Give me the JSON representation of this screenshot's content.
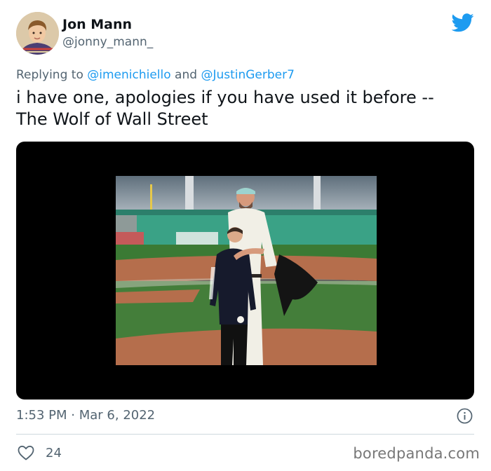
{
  "tweet": {
    "author": {
      "display_name": "Jon Mann",
      "handle": "@jonny_mann_",
      "avatar_icon": "child-portrait-avatar"
    },
    "reply_prefix": "Replying to",
    "reply_mentions": [
      "@imenichiello",
      "@JustinGerber7"
    ],
    "reply_joiner": "and",
    "text_line1": "i have one, apologies if you have used it before --",
    "text_line2": "The Wolf of Wall Street",
    "media": {
      "description_icon": "baseball-field-photo"
    },
    "time": "1:53 PM",
    "separator": "·",
    "date": "Mar 6, 2022",
    "like_count": "24"
  },
  "icons": {
    "brand": "twitter-bird-icon",
    "info": "info-icon",
    "like": "heart-icon"
  },
  "colors": {
    "twitter_blue": "#1d9bf0",
    "secondary_text": "#536471",
    "divider": "#cfd9de"
  },
  "watermark": "boredpanda.com"
}
